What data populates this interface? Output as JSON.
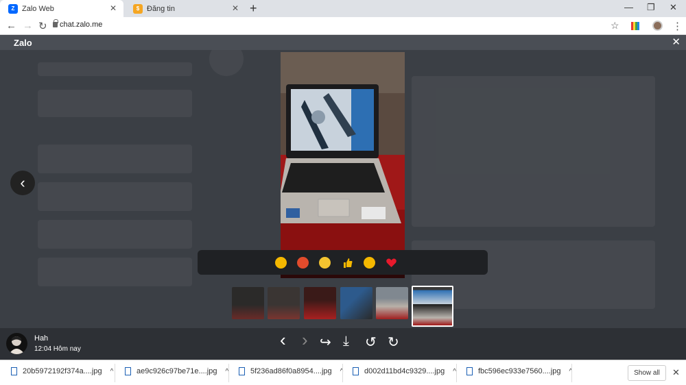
{
  "browser": {
    "tabs": [
      {
        "title": "Zalo Web",
        "active": true
      },
      {
        "title": "Đăng tin",
        "active": false
      }
    ],
    "new_tab_glyph": "+",
    "url": "chat.zalo.me",
    "window_controls": {
      "minimize": "—",
      "restore": "❐",
      "close": "✕"
    },
    "nav": {
      "back": "←",
      "forward": "→",
      "reload": "↻"
    },
    "toolbar_icons": {
      "star": "☆",
      "menu": "⋮"
    }
  },
  "viewer": {
    "app_title": "Zalo",
    "close_glyph": "✕",
    "prev_glyph": "‹",
    "reactions": [
      "laugh-icon",
      "angry-icon",
      "cry-icon",
      "thumbs-up-icon",
      "wow-icon",
      "heart-icon"
    ],
    "thumbnail_count": 6,
    "selected_thumbnail": 6,
    "sender": {
      "name": "Hah",
      "time": "12:04 Hôm nay"
    },
    "controls": {
      "prev": "‹",
      "next": "›",
      "share": "↪",
      "download": "⤓",
      "rotate_left": "↺",
      "rotate_right": "↻"
    }
  },
  "downloads": {
    "items": [
      {
        "name": "20b5972192f374a....jpg"
      },
      {
        "name": "ae9c926c97be71e....jpg"
      },
      {
        "name": "5f236ad86f0a8954....jpg"
      },
      {
        "name": "d002d11bd4c9329....jpg"
      },
      {
        "name": "fbc596ec933e7560....jpg"
      }
    ],
    "caret": "^",
    "show_all": "Show all",
    "close_glyph": "✕"
  },
  "colors": {
    "viewer_bg": "#3b3f45",
    "bottom_bar": "#2d3035",
    "reaction_bar": "#1f2124",
    "zalo_blue": "#0068ff"
  }
}
